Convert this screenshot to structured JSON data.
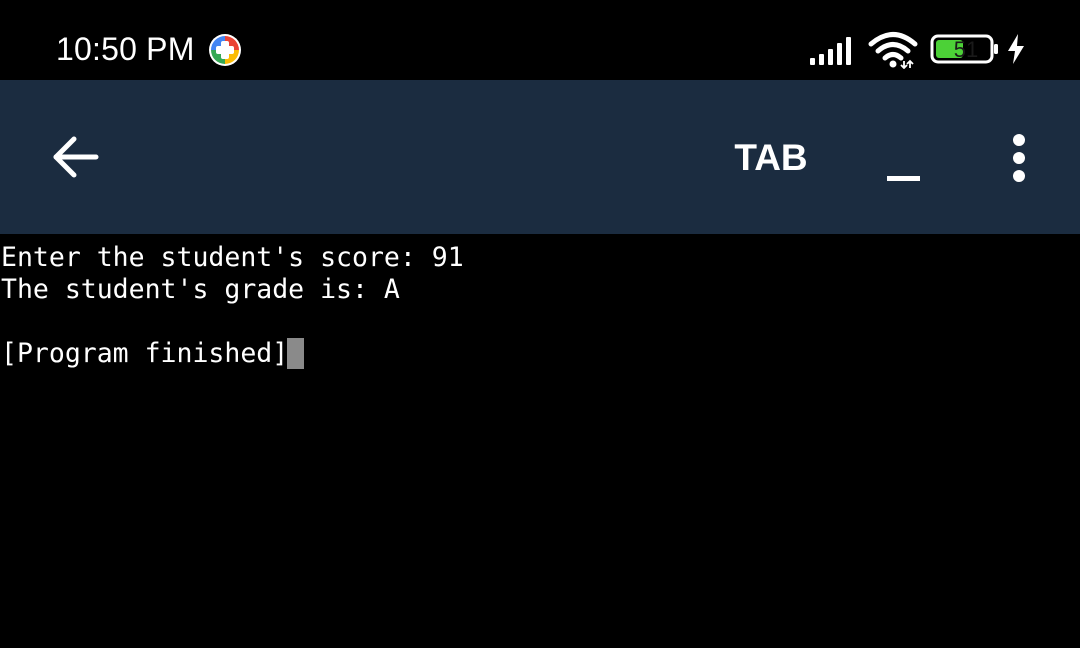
{
  "status_bar": {
    "time": "10:50 PM",
    "battery_level": "51",
    "notification_icon": "google-play-games-icon",
    "icons": [
      "signal-icon",
      "wifi-icon",
      "battery-icon",
      "charging-bolt-icon"
    ],
    "battery_fill_color": "#4cd137"
  },
  "toolbar": {
    "background_color": "#1b2c40",
    "back_icon": "arrow-left-icon",
    "tab_label": "TAB",
    "underscore_label": "_",
    "menu_icon": "more-vert-icon"
  },
  "terminal": {
    "lines": [
      "Enter the student's score: 91",
      "The student's grade is: A",
      "",
      "[Program finished]"
    ],
    "cursor_color": "#8a8a8a"
  }
}
